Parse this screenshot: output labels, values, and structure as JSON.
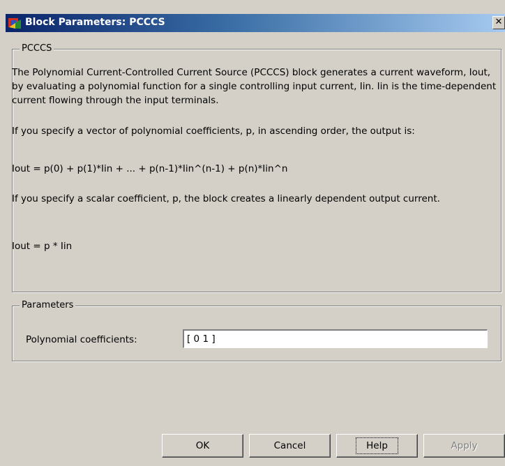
{
  "window": {
    "title": "Block Parameters: PCCCS",
    "close_glyph": "✕"
  },
  "description_group": {
    "legend": "PCCCS",
    "paragraph1": "The Polynomial Current-Controlled Current Source (PCCCS) block generates a current waveform, Iout, by evaluating a polynomial function for a single controlling input current, Iin. Iin is the time-dependent current flowing through the input terminals.",
    "paragraph2": "If you specify a vector of polynomial coefficients, p, in ascending order, the output is:",
    "formula1": "Iout = p(0) + p(1)*Iin + ... + p(n-1)*Iin^(n-1) +  p(n)*Iin^n",
    "paragraph3": "If you specify a scalar coefficient, p, the block creates a linearly dependent output current.",
    "formula2": "Iout = p * Iin"
  },
  "parameters_group": {
    "legend": "Parameters",
    "poly_label": "Polynomial coefficients:",
    "poly_value": "[ 0 1 ]"
  },
  "buttons": {
    "ok": "OK",
    "cancel": "Cancel",
    "help": "Help",
    "apply": "Apply"
  },
  "colors": {
    "title_bar_start": "#0a246a",
    "title_bar_end": "#a6caf0",
    "dialog_bg": "#d4d0c8"
  }
}
